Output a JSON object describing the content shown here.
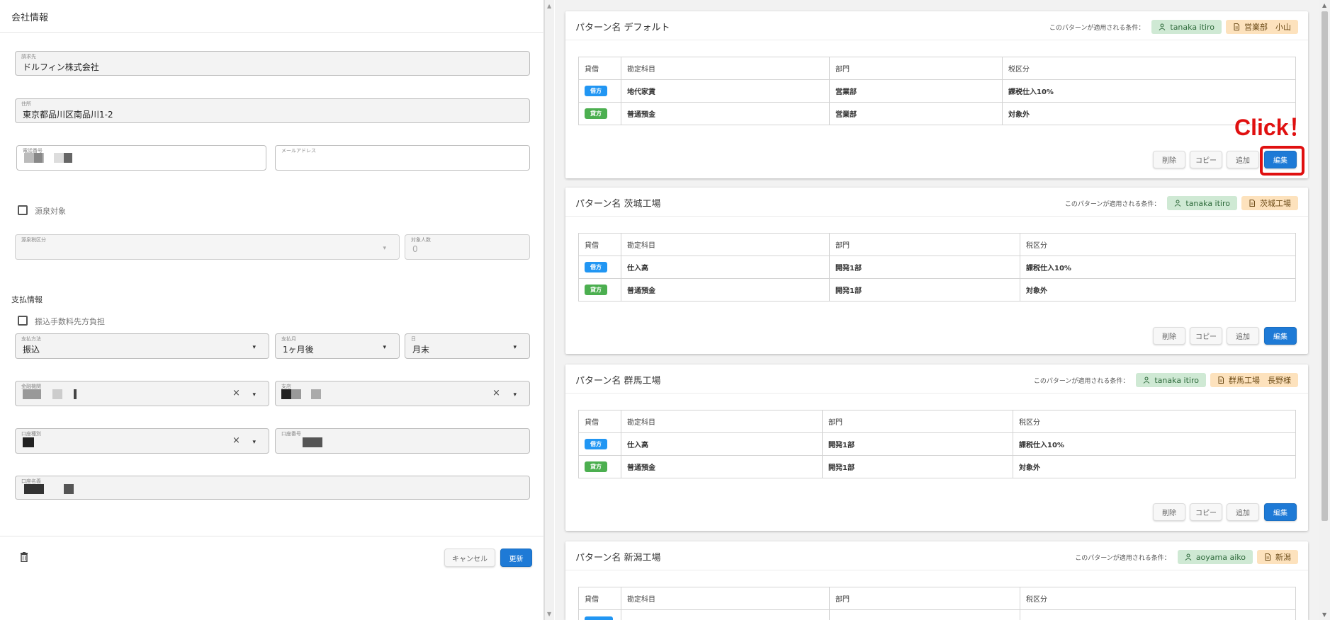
{
  "left": {
    "title": "会社情報",
    "billing_label": "請求先",
    "billing_value": "ドルフィン株式会社",
    "address_label": "住所",
    "address_value": "東京都品川区南品川1-2",
    "phone_label": "電話番号",
    "email_label": "メールアドレス",
    "withholding_label": "源泉対象",
    "withholding_type_label": "源泉税区分",
    "people_label": "対象人数",
    "people_value": "0",
    "payment_section": "支払情報",
    "fee_label": "振込手数料先方負担",
    "method_label": "支払方法",
    "method_value": "振込",
    "month_label": "支払月",
    "month_value": "1ヶ月後",
    "day_label": "日",
    "day_value": "月末",
    "bank_label": "金融機関",
    "branch_label": "支店",
    "account_type_label": "口座種別",
    "account_number_label": "口座番号",
    "account_name_label": "口座名義",
    "cancel_label": "キャンセル",
    "update_label": "更新"
  },
  "headers": [
    "貸借",
    "勘定科目",
    "部門",
    "税区分"
  ],
  "condition_label": "このパターンが適用される条件：",
  "actions": {
    "delete": "削除",
    "copy": "コピー",
    "add": "追加",
    "edit": "編集"
  },
  "annotation": "Click！",
  "patterns": [
    {
      "title": "パターン名 デフォルト",
      "user": "tanaka itiro",
      "dept": "営業部　小山",
      "rows": [
        {
          "side": "借方",
          "account": "地代家賃",
          "department": "営業部",
          "tax": "課税仕入10%"
        },
        {
          "side": "貸方",
          "account": "普通預金",
          "department": "営業部",
          "tax": "対象外"
        }
      ]
    },
    {
      "title": "パターン名 茨城工場",
      "user": "tanaka itiro",
      "dept": "茨城工場",
      "rows": [
        {
          "side": "借方",
          "account": "仕入高",
          "department": "開発1部",
          "tax": "課税仕入10%"
        },
        {
          "side": "貸方",
          "account": "普通預金",
          "department": "開発1部",
          "tax": "対象外"
        }
      ]
    },
    {
      "title": "パターン名 群馬工場",
      "user": "tanaka itiro",
      "dept": "群馬工場　長野様",
      "rows": [
        {
          "side": "借方",
          "account": "仕入高",
          "department": "開発1部",
          "tax": "課税仕入10%"
        },
        {
          "side": "貸方",
          "account": "普通預金",
          "department": "開発1部",
          "tax": "対象外"
        }
      ]
    },
    {
      "title": "パターン名 新潟工場",
      "user": "aoyama aiko",
      "dept": "新潟",
      "rows": []
    }
  ],
  "colors": {
    "accent": "#1e7ad6",
    "debit": "#2196f3",
    "credit": "#4caf50",
    "annotation": "#e01010"
  }
}
